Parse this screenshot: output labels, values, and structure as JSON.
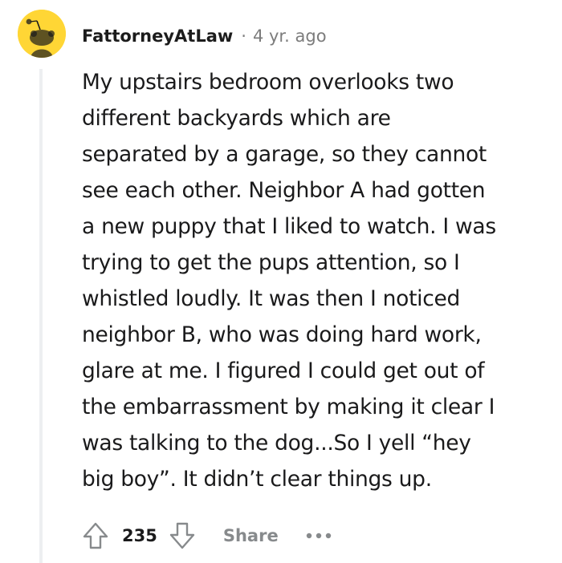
{
  "comment": {
    "author": "FattorneyAtLaw",
    "separator": "·",
    "timestamp": "4 yr. ago",
    "avatar": {
      "icon": "reddit-snoo-avatar-icon",
      "background": "#ffd635"
    },
    "body_lines": [
      "My upstairs bedroom overlooks two",
      "different backyards which are",
      "separated by a garage, so they cannot",
      "see each other. Neighbor A had gotten",
      "a new puppy that I liked to watch. I was",
      "trying to get the pups attention, so I",
      "whistled loudly. It was then I noticed",
      "neighbor B, who was doing hard work,",
      "glare at me. I figured I could get out of",
      "the embarrassment by making it clear I",
      "was talking to the dog...So I yell “hey",
      "big boy”. It didn’t clear things up."
    ]
  },
  "actions": {
    "upvote_icon": "upvote-arrow-icon",
    "vote_count": "235",
    "downvote_icon": "downvote-arrow-icon",
    "share_label": "Share",
    "more_icon": "more-options-icon"
  },
  "colors": {
    "text": "#1a1a1b",
    "muted": "#7c7c7c",
    "action_gray": "#878a8c",
    "thread_line": "#edeff1"
  }
}
